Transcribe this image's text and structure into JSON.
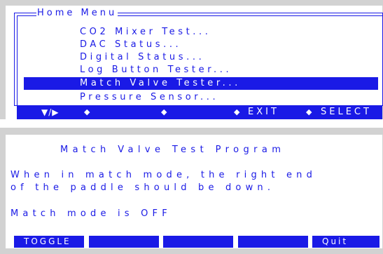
{
  "home_menu": {
    "title": "Home Menu",
    "items": [
      {
        "label": "CO2 Mixer Test..."
      },
      {
        "label": "DAC Status..."
      },
      {
        "label": "Digital Status..."
      },
      {
        "label": "Log Button Tester..."
      },
      {
        "label": "Match Valve Tester...",
        "selected": true
      },
      {
        "label": "Pressure Sensor..."
      }
    ],
    "function_bar": {
      "nav_label": "▼/▶",
      "f2_marker": "◆",
      "f3_marker": "◆",
      "f4_marker": "◆",
      "f4_label": "EXIT",
      "f5_marker": "◆",
      "f5_label": "SELECT"
    }
  },
  "program": {
    "title": "Match Valve Test Program",
    "lines": [
      "When in match mode, the right end",
      "of the paddle should be down.",
      "Match mode is OFF"
    ],
    "softkeys": [
      "TOGGLE",
      "",
      "",
      "",
      "Quit"
    ]
  },
  "colors": {
    "text": "#1a1ae6",
    "panel_background": "#d2d2d2",
    "screen_background": "#ffffff"
  }
}
